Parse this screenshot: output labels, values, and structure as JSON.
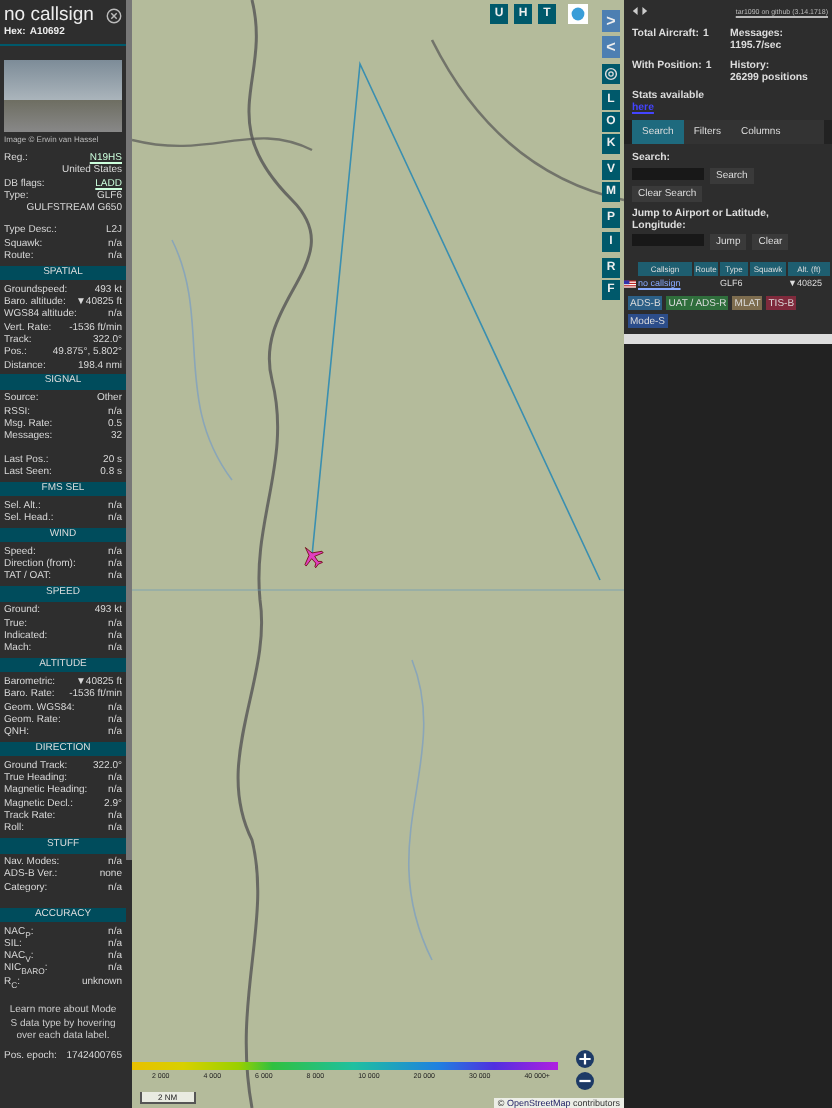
{
  "aircraft_panel": {
    "callsign": "no callsign",
    "hex_label": "Hex:",
    "hex": "A10692",
    "photo_caption": "Image © Erwin van Hassel",
    "sections": [
      {
        "rows": [
          {
            "kind": "link_pair",
            "label": "Reg.:",
            "value": "N19HS"
          },
          {
            "kind": "value",
            "value": "United States"
          },
          {
            "kind": "link_pair",
            "label": "DB flags:",
            "value": "LADD"
          },
          {
            "kind": "pair",
            "label": "Type:",
            "value": "GLF6"
          },
          {
            "kind": "value",
            "value": "GULFSTREAM G650"
          },
          {
            "kind": "gap"
          },
          {
            "kind": "pair",
            "label": "Type Desc.:",
            "value": "L2J"
          },
          {
            "kind": "pair",
            "label": "Squawk:",
            "value": "n/a"
          },
          {
            "kind": "pair",
            "label": "Route:",
            "value": "n/a"
          }
        ]
      },
      {
        "title": "SPATIAL",
        "rows": [
          {
            "kind": "pair",
            "label": "Groundspeed:",
            "value": "493 kt"
          },
          {
            "kind": "pair",
            "label": "Baro. altitude:",
            "value": "▼40825 ft"
          },
          {
            "kind": "pair",
            "label": "WGS84 altitude:",
            "value": "n/a"
          },
          {
            "kind": "pair",
            "label": "Vert. Rate:",
            "value": "-1536 ft/min"
          },
          {
            "kind": "pair",
            "label": "Track:",
            "value": "322.0°"
          },
          {
            "kind": "pair",
            "label": "Pos.:",
            "value": "49.875°, 5.802°"
          },
          {
            "kind": "pair",
            "label": "Distance:",
            "value": "198.4 nmi"
          }
        ]
      },
      {
        "title": "SIGNAL",
        "rows": [
          {
            "kind": "pair",
            "label": "Source:",
            "value": "Other"
          },
          {
            "kind": "pair",
            "label": "RSSI:",
            "value": "n/a"
          },
          {
            "kind": "pair",
            "label": "Msg. Rate:",
            "value": "0.5"
          },
          {
            "kind": "pair",
            "label": "Messages:",
            "value": "32"
          },
          {
            "kind": "gap"
          },
          {
            "kind": "pair",
            "label": "Last Pos.:",
            "value": "20 s"
          },
          {
            "kind": "pair",
            "label": "Last Seen:",
            "value": "0.8 s"
          }
        ]
      },
      {
        "title": "FMS SEL",
        "rows": [
          {
            "kind": "pair",
            "label": "Sel. Alt.:",
            "value": "n/a"
          },
          {
            "kind": "pair",
            "label": "Sel. Head.:",
            "value": "n/a"
          }
        ]
      },
      {
        "title": "WIND",
        "rows": [
          {
            "kind": "pair",
            "label": "Speed:",
            "value": "n/a"
          },
          {
            "kind": "pair",
            "label": "Direction (from):",
            "value": "n/a"
          },
          {
            "kind": "pair",
            "label": "TAT / OAT:",
            "value": "n/a"
          }
        ]
      },
      {
        "title": "SPEED",
        "rows": [
          {
            "kind": "pair",
            "label": "Ground:",
            "value": "493 kt"
          },
          {
            "kind": "pair",
            "label": "True:",
            "value": "n/a"
          },
          {
            "kind": "pair",
            "label": "Indicated:",
            "value": "n/a"
          },
          {
            "kind": "pair",
            "label": "Mach:",
            "value": "n/a"
          }
        ]
      },
      {
        "title": "ALTITUDE",
        "rows": [
          {
            "kind": "pair",
            "label": "Barometric:",
            "value": "▼40825 ft"
          },
          {
            "kind": "pair",
            "label": "Baro. Rate:",
            "value": "-1536 ft/min"
          },
          {
            "kind": "pair",
            "label": "Geom. WGS84:",
            "value": "n/a"
          },
          {
            "kind": "pair",
            "label": "Geom. Rate:",
            "value": "n/a"
          },
          {
            "kind": "pair",
            "label": "QNH:",
            "value": "n/a"
          }
        ]
      },
      {
        "title": "DIRECTION",
        "rows": [
          {
            "kind": "pair",
            "label": "Ground Track:",
            "value": "322.0°"
          },
          {
            "kind": "pair",
            "label": "True Heading:",
            "value": "n/a"
          },
          {
            "kind": "pair",
            "label": "Magnetic Heading:",
            "value": "n/a"
          },
          {
            "kind": "pair",
            "label": "Magnetic Decl.:",
            "value": "2.9°"
          },
          {
            "kind": "pair",
            "label": "Track Rate:",
            "value": "n/a"
          },
          {
            "kind": "pair",
            "label": "Roll:",
            "value": "n/a"
          }
        ]
      },
      {
        "title": "STUFF",
        "rows": [
          {
            "kind": "pair",
            "label": "Nav. Modes:",
            "value": "n/a"
          },
          {
            "kind": "pair",
            "label": "ADS-B Ver.:",
            "value": "none"
          },
          {
            "kind": "pair",
            "label": "Category:",
            "value": "n/a"
          },
          {
            "kind": "gap"
          }
        ]
      },
      {
        "title": "ACCURACY",
        "rows": [
          {
            "kind": "pair",
            "label": "NAC$_{P}$:",
            "value": "n/a"
          },
          {
            "kind": "pair",
            "label": "SIL:",
            "value": "n/a"
          },
          {
            "kind": "pair",
            "label": "NAC$_{V}$:",
            "value": "n/a"
          },
          {
            "kind": "pair",
            "label": "NIC$_{BARO}$:",
            "value": "n/a"
          },
          {
            "kind": "pair",
            "label": "R$_{C}$:",
            "value": "unknown"
          }
        ]
      }
    ],
    "note": "Learn more about Mode S data type by hovering over each data label.",
    "epoch_label": "Pos. epoch:",
    "epoch": "1742400765"
  },
  "map": {
    "top_buttons": [
      "U",
      "H",
      "T"
    ],
    "side_buttons": [
      {
        "kind": "arrow",
        "label": ">"
      },
      {
        "kind": "arrow",
        "label": "<"
      },
      {
        "kind": "settings"
      },
      {
        "kind": "letter",
        "label": "L"
      },
      {
        "kind": "letter",
        "label": "O"
      },
      {
        "kind": "letter",
        "label": "K"
      },
      {
        "kind": "letter",
        "label": "V"
      },
      {
        "kind": "letter",
        "label": "M"
      },
      {
        "kind": "letter",
        "label": "P"
      },
      {
        "kind": "letter",
        "label": "I"
      },
      {
        "kind": "letter",
        "label": "R"
      },
      {
        "kind": "letter",
        "label": "F"
      }
    ],
    "altitude_scale": [
      "2 000",
      "4 000",
      "6 000",
      "8 000",
      "10 000",
      "20 000",
      "30 000",
      "40 000+"
    ],
    "scale_bar": "2 NM",
    "attribution_prefix": "©",
    "attribution_link": "OpenStreetMap",
    "attribution_suffix": "contributors"
  },
  "list_panel": {
    "version_link": "tar1090 on github (3.14.1718)",
    "stats": [
      {
        "label": "Total Aircraft:",
        "value": "1"
      },
      {
        "label": "Messages:",
        "value": "1195.7/sec"
      },
      {
        "label": "With Position:",
        "value": "1"
      },
      {
        "label": "History:",
        "value": "26299 positions"
      }
    ],
    "stats_text": "Stats available",
    "stats_link": "here",
    "tabs": [
      {
        "label": "Search",
        "selected": true
      },
      {
        "label": "Filters",
        "selected": false
      },
      {
        "label": "Columns",
        "selected": false
      }
    ],
    "search_label": "Search:",
    "search_button": "Search",
    "clear_search_button": "Clear Search",
    "jump_label": "Jump to Airport or Latitude, Longitude:",
    "jump_button": "Jump",
    "clear_button": "Clear",
    "table": {
      "columns": [
        "Callsign",
        "Route",
        "Type",
        "Squawk",
        "Alt. (ft)"
      ],
      "rows": [
        {
          "callsign": "no callsign",
          "type": "GLF6",
          "altitude": "▼40825"
        }
      ]
    },
    "legend": [
      {
        "label": "ADS-B",
        "color": "#2b5f86"
      },
      {
        "label": "UAT / ADS-R",
        "color": "#2f6e3c"
      },
      {
        "label": "MLAT",
        "color": "#7d6c4e"
      },
      {
        "label": "TIS-B",
        "color": "#7f2a3c"
      },
      {
        "label": "Mode-S",
        "color": "#2c4d8a"
      }
    ]
  }
}
